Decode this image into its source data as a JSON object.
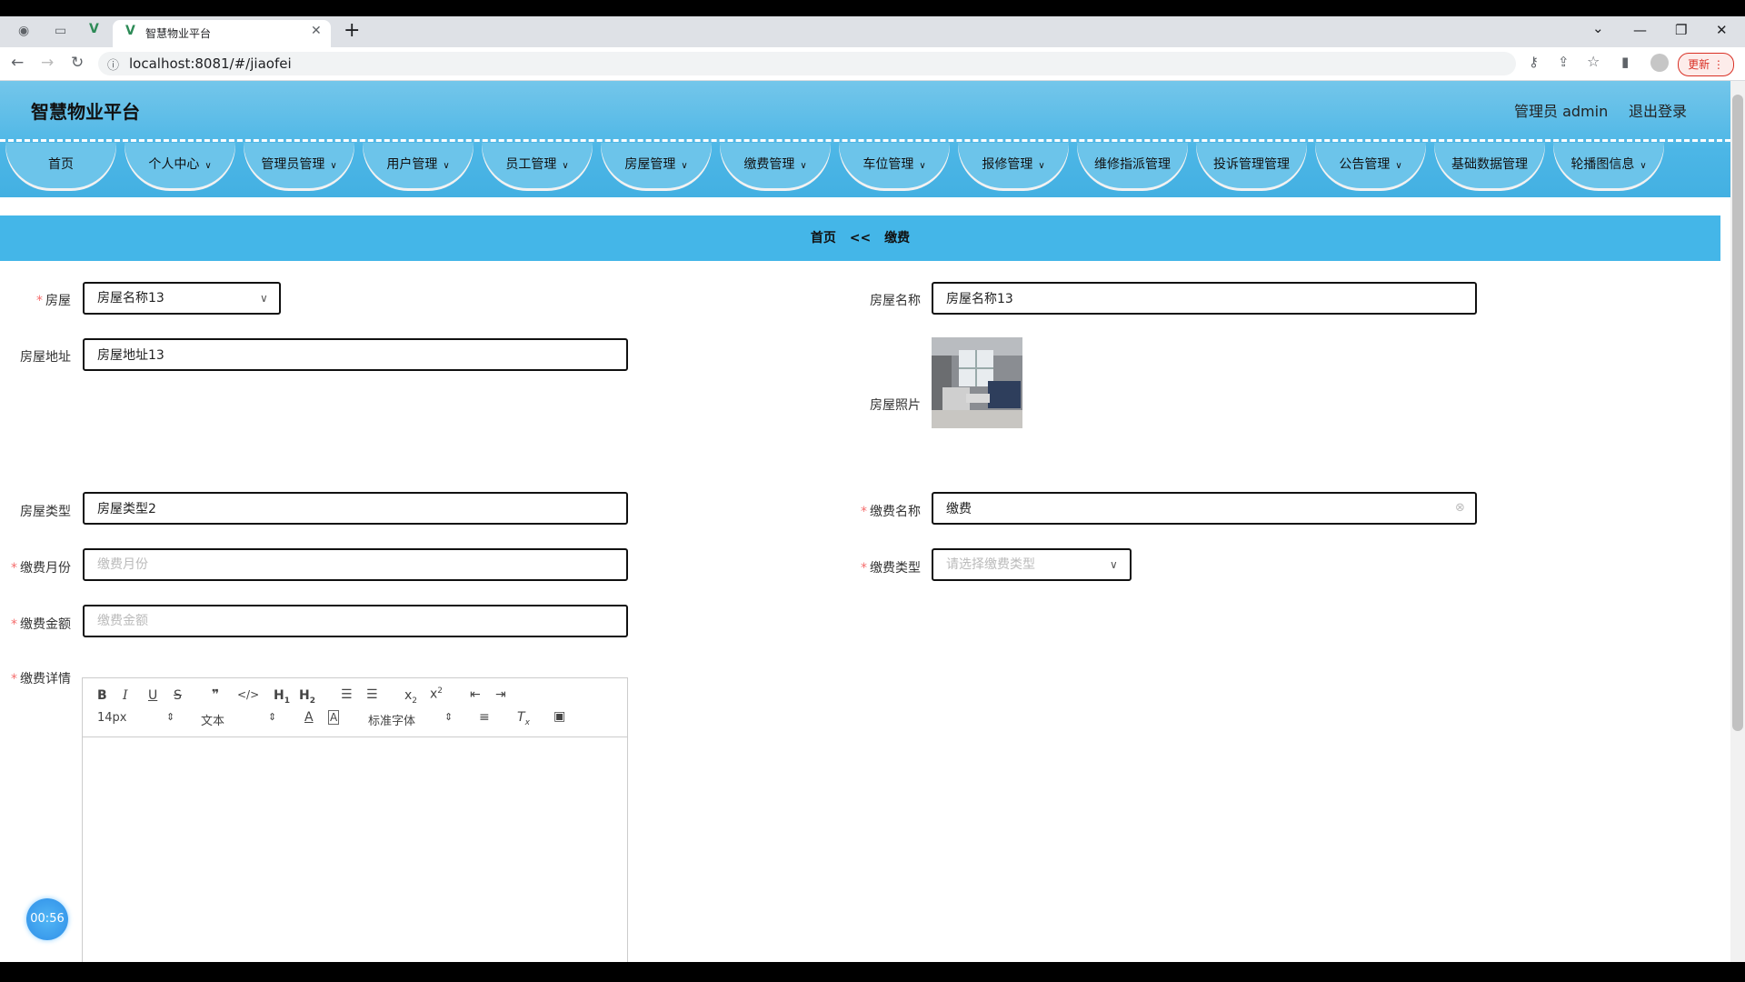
{
  "browser": {
    "tab_title": "智慧物业平台",
    "new_tab": "+",
    "url": "localhost:8081/#/jiaofei",
    "update_label": "更新",
    "controls": {
      "minimize": "—",
      "restore": "❐",
      "close": "✕",
      "dropdown": "⌄"
    }
  },
  "header": {
    "logo": "智慧物业平台",
    "user": "管理员 admin",
    "logout": "退出登录"
  },
  "nav": [
    {
      "label": "首页",
      "dropdown": false
    },
    {
      "label": "个人中心",
      "dropdown": true
    },
    {
      "label": "管理员管理",
      "dropdown": true
    },
    {
      "label": "用户管理",
      "dropdown": true
    },
    {
      "label": "员工管理",
      "dropdown": true
    },
    {
      "label": "房屋管理",
      "dropdown": true
    },
    {
      "label": "缴费管理",
      "dropdown": true
    },
    {
      "label": "车位管理",
      "dropdown": true
    },
    {
      "label": "报修管理",
      "dropdown": true
    },
    {
      "label": "维修指派管理",
      "dropdown": false
    },
    {
      "label": "投诉管理管理",
      "dropdown": false
    },
    {
      "label": "公告管理",
      "dropdown": true
    },
    {
      "label": "基础数据管理",
      "dropdown": false
    },
    {
      "label": "轮播图信息",
      "dropdown": true
    }
  ],
  "breadcrumb": {
    "home": "首页",
    "sep": "<<",
    "current": "缴费"
  },
  "form": {
    "house": {
      "label": "房屋",
      "value": "房屋名称13"
    },
    "house_name": {
      "label": "房屋名称",
      "value": "房屋名称13"
    },
    "house_address": {
      "label": "房屋地址",
      "value": "房屋地址13"
    },
    "house_photo": {
      "label": "房屋照片"
    },
    "house_type": {
      "label": "房屋类型",
      "value": "房屋类型2"
    },
    "fee_name": {
      "label": "缴费名称",
      "value": "缴费"
    },
    "fee_month": {
      "label": "缴费月份",
      "placeholder": "缴费月份"
    },
    "fee_type": {
      "label": "缴费类型",
      "placeholder": "请选择缴费类型"
    },
    "fee_amount": {
      "label": "缴费金额",
      "placeholder": "缴费金额"
    },
    "fee_detail": {
      "label": "缴费详情"
    }
  },
  "editor": {
    "font_size": "14px",
    "text_style": "文本",
    "font_family": "标准字体"
  },
  "timer": "00:56",
  "colors": {
    "accent": "#44b6e8",
    "required": "#f56c6c"
  }
}
